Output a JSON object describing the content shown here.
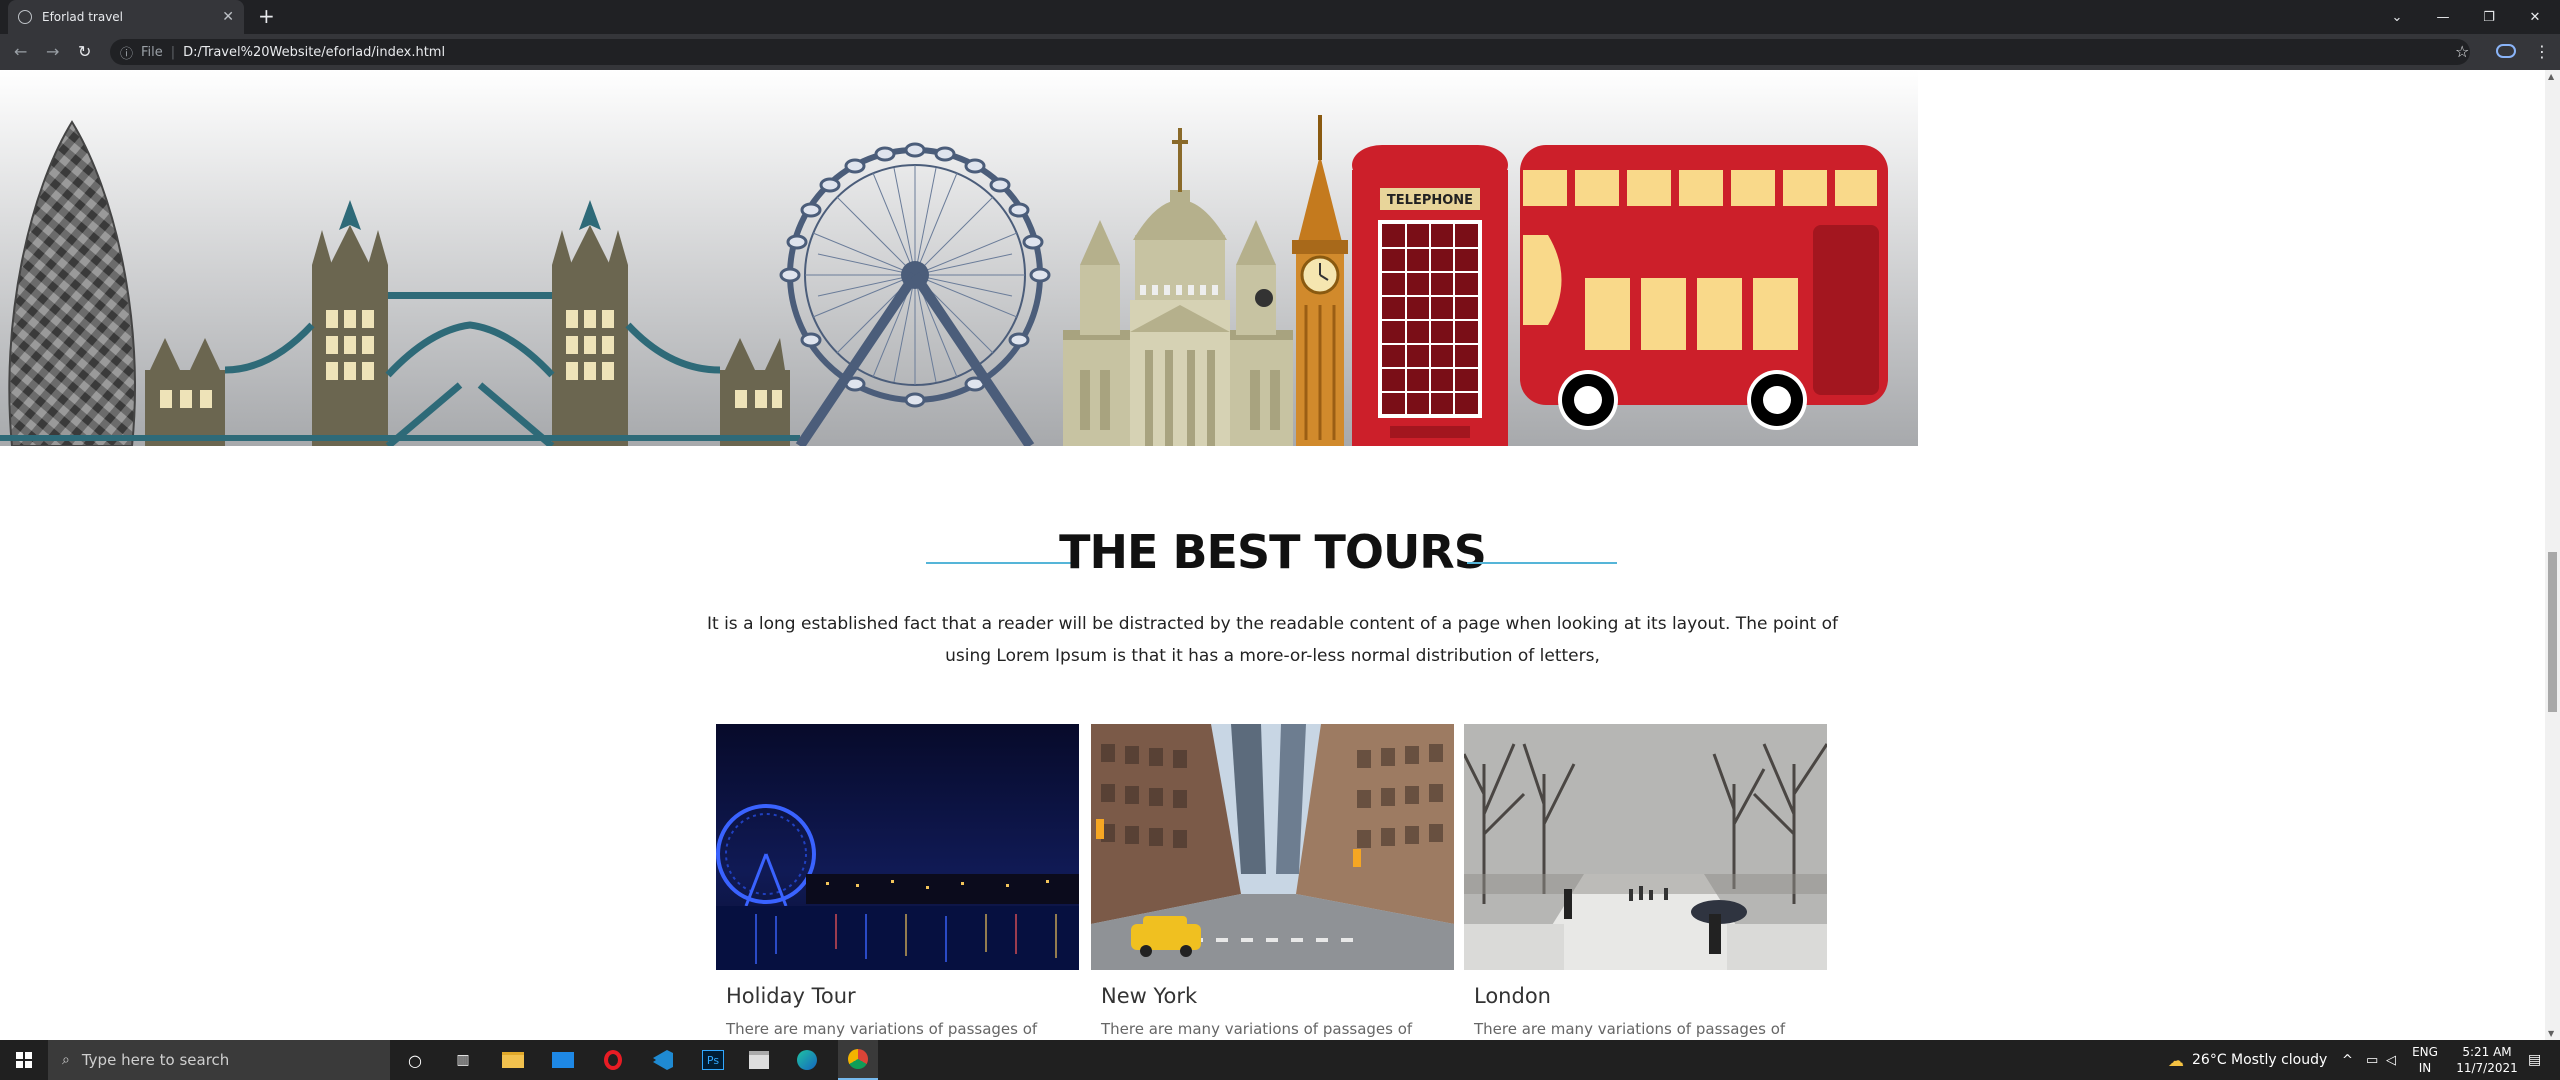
{
  "browser": {
    "tab_title": "Eforlad travel",
    "tab_close": "✕",
    "new_tab": "+",
    "info_icon": "ⓘ",
    "file_label": "File",
    "separator": "|",
    "url": "D:/Travel%20Website/eforlad/index.html",
    "star": "☆",
    "menu": "⋮"
  },
  "hero": {
    "telephone_label": "TELEPHONE"
  },
  "section": {
    "title": "THE BEST TOURS",
    "lead": "It is a long established fact that a reader will be distracted by the readable content of a page when looking at its layout. The point of using Lorem Ipsum is that it has a more-or-less normal distribution of letters,"
  },
  "cards": [
    {
      "title": "Holiday Tour",
      "text": "There are many variations of passages of"
    },
    {
      "title": "New York",
      "text": "There are many variations of passages of"
    },
    {
      "title": "London",
      "text": "There are many variations of passages of"
    }
  ],
  "taskbar": {
    "search_placeholder": "Type here to search",
    "weather": "26°C  Mostly cloudy",
    "lang_line1": "ENG",
    "lang_line2": "IN",
    "time": "5:21 AM",
    "date": "11/7/2021"
  },
  "colors": {
    "accent": "#55b5d8",
    "bus_red": "#cc1f2a",
    "landmark_olive": "#6b6650"
  }
}
